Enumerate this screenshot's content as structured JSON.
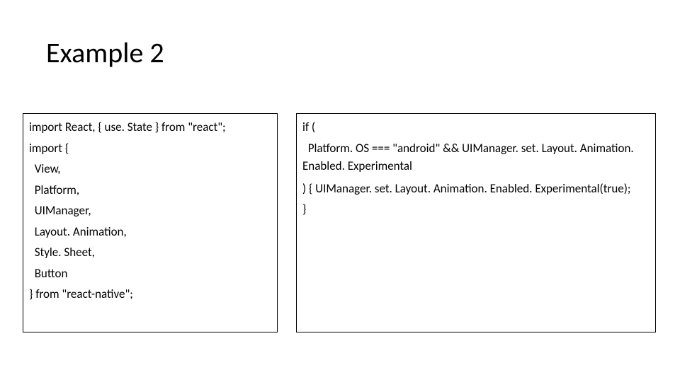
{
  "slide": {
    "title": "Example 2"
  },
  "left_box": {
    "l1": "import React, { use. State } from \"react\";",
    "l2": "import {",
    "l3": "  View,",
    "l4": "  Platform,",
    "l5": "  UIManager,",
    "l6": "  Layout. Animation,",
    "l7": "  Style. Sheet,",
    "l8": "  Button",
    "l9": "} from \"react-native\";"
  },
  "right_box": {
    "b1_l1": "if (",
    "b1_l2": "  Platform. OS === \"android\" && UIManager. set. Layout. Animation. Enabled. Experimental",
    "b2_l1": ") { UIManager. set. Layout. Animation. Enabled. Experimental(true);",
    "b2_l2": "}"
  }
}
